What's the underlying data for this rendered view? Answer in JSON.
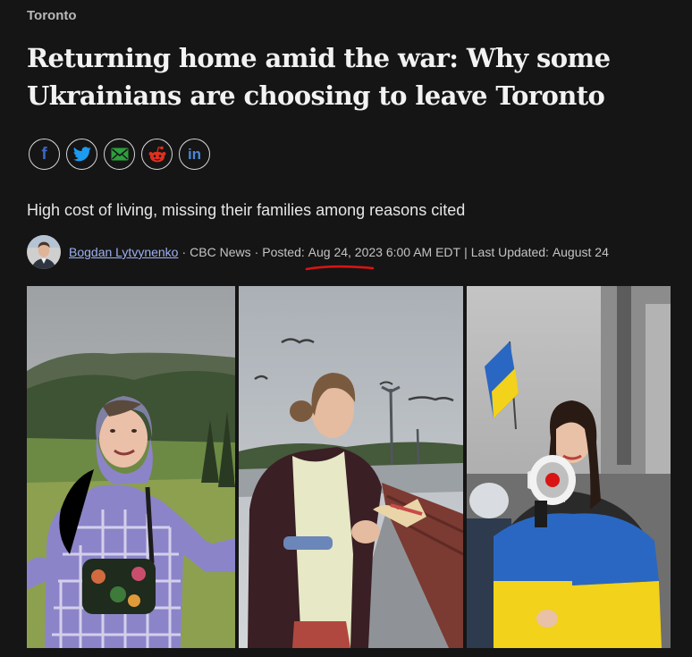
{
  "section": "Toronto",
  "headline": "Returning home amid the war: Why some Ukrainians are choosing to leave Toronto",
  "share": {
    "icons": [
      "facebook-icon",
      "twitter-icon",
      "email-icon",
      "reddit-icon",
      "linkedin-icon"
    ],
    "facebook_glyph": "f",
    "linkedin_glyph": "in"
  },
  "dek": "High cost of living, missing their families among reasons cited",
  "byline": {
    "author": "Bogdan Lytvynenko",
    "outlet": "CBC News",
    "posted_label": "Posted:",
    "posted_date": "Aug 24, 2023",
    "posted_time": "6:00 AM EDT",
    "updated_label": "Last Updated:",
    "updated_date": "August 24",
    "sep_dot": "·",
    "sep_bar": "|"
  },
  "colors": {
    "background": "#151515",
    "link": "#9db0f0",
    "annotation": "#d81414",
    "ukraine_blue": "#2a67c2",
    "ukraine_yellow": "#f2d21a"
  },
  "photos": [
    {
      "name": "woman-plaid-jacket-mountains"
    },
    {
      "name": "young-man-seagulls-pier"
    },
    {
      "name": "woman-megaphone-ukrainian-flag"
    }
  ]
}
